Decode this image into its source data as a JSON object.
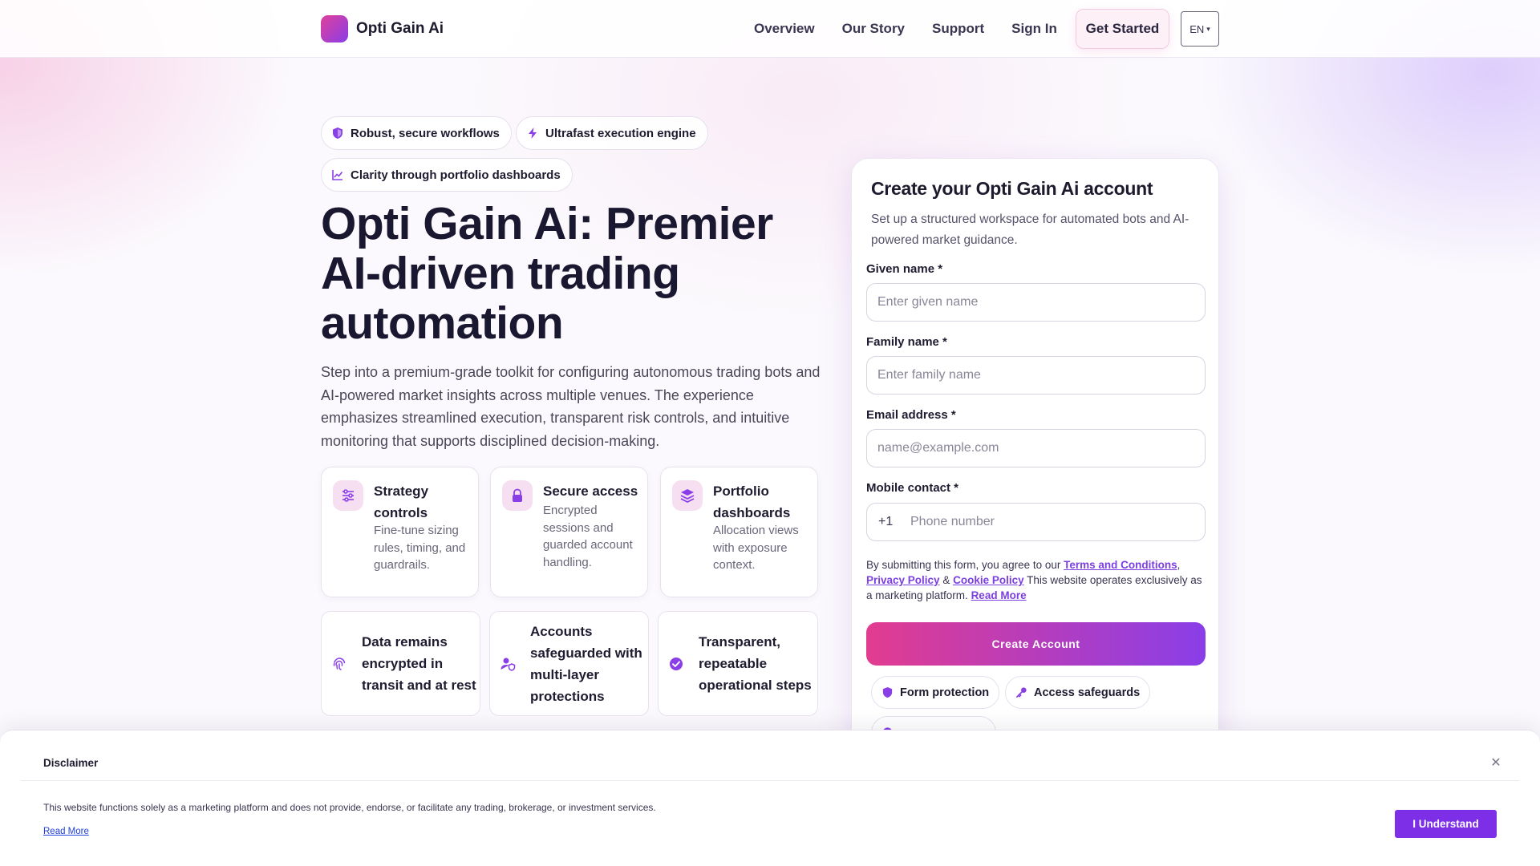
{
  "header": {
    "brand": "Opti Gain Ai",
    "nav": [
      "Overview",
      "Our Story",
      "Support",
      "Sign In"
    ],
    "cta": "Get Started",
    "language": "EN"
  },
  "hero": {
    "pills": [
      "Robust, secure workflows",
      "Ultrafast execution engine",
      "Clarity through portfolio dashboards"
    ],
    "title": "Opti Gain Ai: Premier AI-driven trading automation",
    "description": "Step into a premium-grade toolkit for configuring autonomous trading bots and AI-powered market insights across multiple venues. The experience emphasizes streamlined execution, transparent risk controls, and intuitive monitoring that supports disciplined decision-making.",
    "features": [
      {
        "title": "Strategy controls",
        "desc": "Fine-tune sizing rules, timing, and guardrails."
      },
      {
        "title": "Secure access",
        "desc": "Encrypted sessions and guarded account handling."
      },
      {
        "title": "Portfolio dashboards",
        "desc": "Allocation views with exposure context."
      }
    ],
    "trust": [
      "Data remains encrypted in transit and at rest",
      "Accounts safeguarded with multi-layer protections",
      "Transparent, repeatable operational steps"
    ]
  },
  "form": {
    "title": "Create your Opti Gain Ai account",
    "subtitle": "Set up a structured workspace for automated bots and AI-powered market guidance.",
    "given_label": "Given name *",
    "given_placeholder": "Enter given name",
    "family_label": "Family name *",
    "family_placeholder": "Enter family name",
    "email_label": "Email address *",
    "email_placeholder": "name@example.com",
    "phone_label": "Mobile contact *",
    "phone_prefix": "+1",
    "phone_placeholder": "Phone number",
    "legal_prefix": "By submitting this form, you agree to our ",
    "terms": "Terms and Conditions",
    "privacy": "Privacy Policy",
    "cookie": "Cookie Policy",
    "legal_mid": " This website operates exclusively as a marketing platform. ",
    "read_more": "Read More",
    "submit": "Create Account",
    "badges": [
      "Form protection",
      "Access safeguards"
    ]
  },
  "disclaimer": {
    "title": "Disclaimer",
    "text": "This website functions solely as a marketing platform and does not provide, endorse, or facilitate any trading, brokerage, or investment services.",
    "read_more": "Read More",
    "button": "I Understand"
  },
  "colors": {
    "accent_pink": "#e23c8f",
    "accent_purple": "#8a3ee8",
    "button_purple": "#7c2fe6"
  }
}
